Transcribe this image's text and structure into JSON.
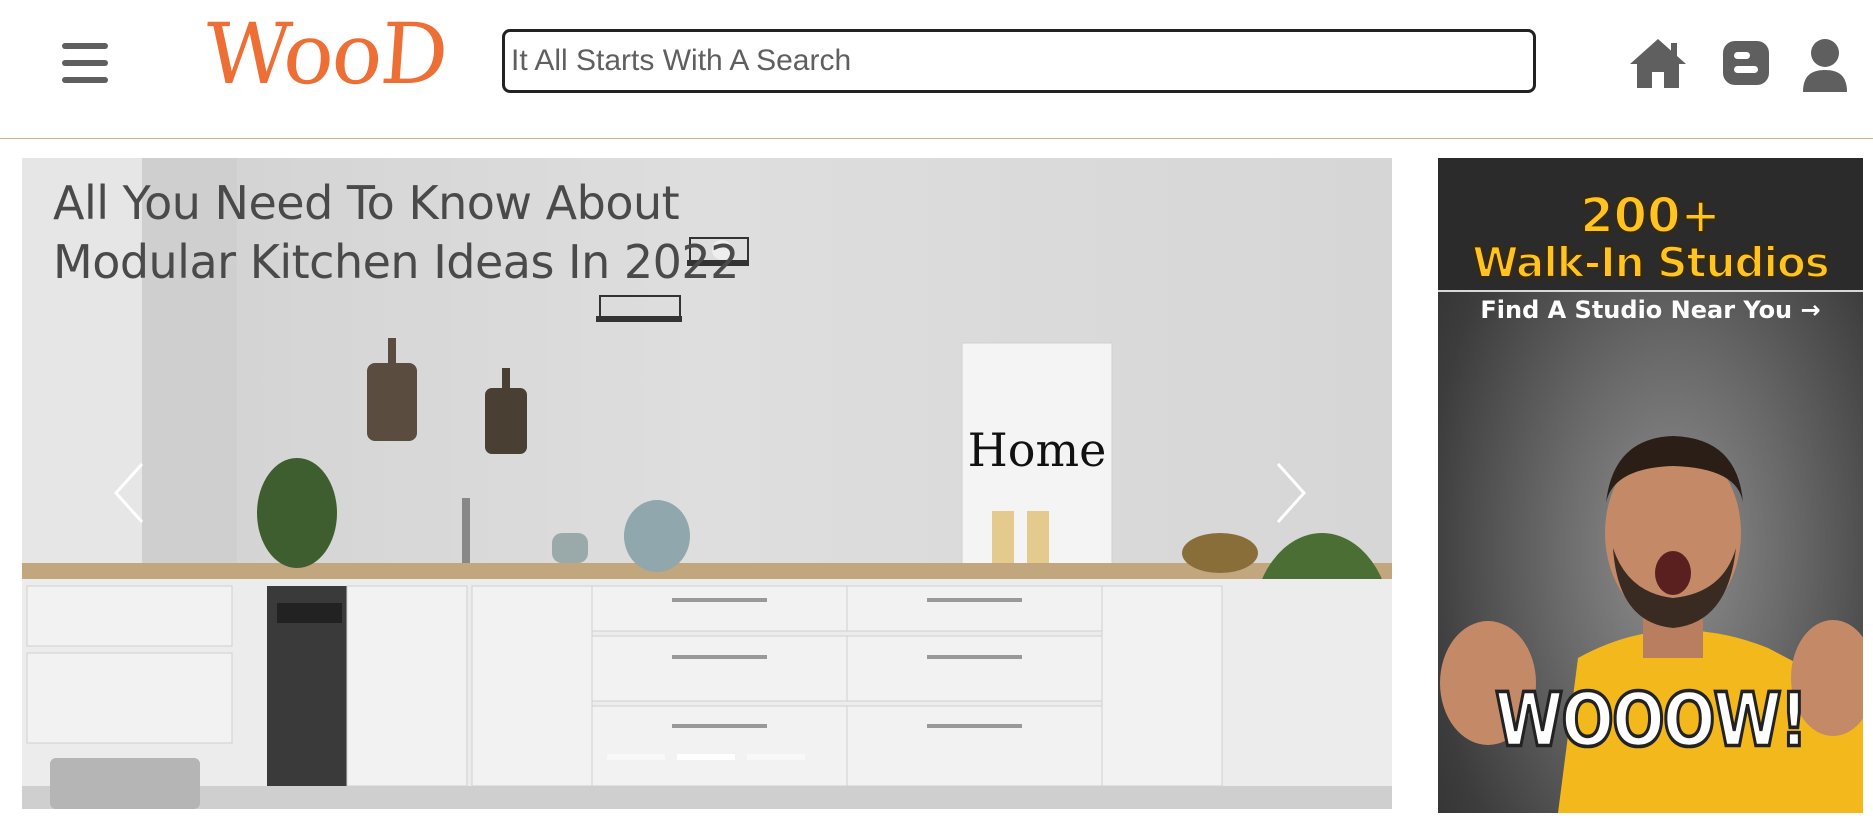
{
  "header": {
    "logo_text": "WooD",
    "search_placeholder": "It All Starts With A Search",
    "icons": [
      "menu-icon",
      "home-icon",
      "blogger-icon",
      "user-icon"
    ]
  },
  "hero": {
    "title_line1": "All You Need To Know About",
    "title_line2": "Modular Kitchen Ideas In 2022",
    "poster_text": "Home",
    "slide_count": 3,
    "active_slide": 2
  },
  "ad": {
    "headline_number": "200+",
    "headline_text": "Walk-In Studios",
    "cta": "Find A Studio Near You",
    "tagline": "WOOOW!"
  },
  "colors": {
    "logo": "#ee6f35",
    "icon": "#5f5f5f",
    "ad_yellow": "#ffc422",
    "divider": "#c8b98c"
  }
}
